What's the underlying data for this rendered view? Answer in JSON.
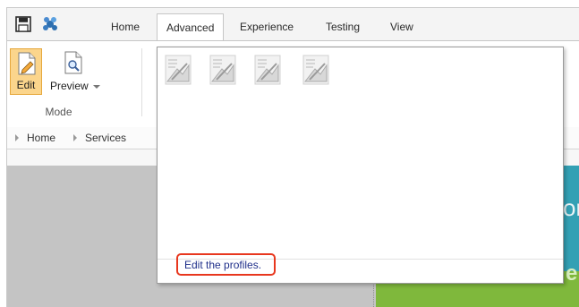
{
  "tabs": [
    {
      "label": "Home",
      "active": false
    },
    {
      "label": "Advanced",
      "active": true
    },
    {
      "label": "Experience",
      "active": false
    },
    {
      "label": "Testing",
      "active": false
    },
    {
      "label": "View",
      "active": false
    }
  ],
  "quick_access": {
    "save_icon": "save-icon",
    "app_icon": "app-logo-icon"
  },
  "ribbon": {
    "edit_label": "Edit",
    "preview_label": "Preview",
    "group_label": "Mode"
  },
  "breadcrumb": [
    "Home",
    "Services"
  ],
  "popup": {
    "thumbnail_count": 4,
    "link_text": "Edit the profiles."
  },
  "colors": {
    "edit_active": "#fbd58c",
    "link": "#1f2f8a",
    "highlight": "#e8371e",
    "page_green": "#7fb83c",
    "page_teal": "#33a0b4"
  }
}
